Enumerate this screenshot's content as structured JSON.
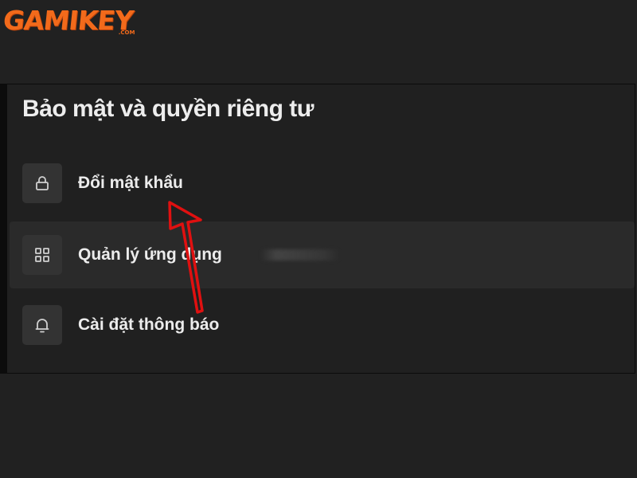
{
  "logo": {
    "text": "GAMIKEY",
    "sub": ".COM"
  },
  "settings": {
    "title": "Bảo mật và quyền riêng tư",
    "items": [
      {
        "label": "Đổi mật khẩu",
        "icon": "lock-icon"
      },
      {
        "label": "Quản lý ứng dụng",
        "icon": "grid-apps-icon"
      },
      {
        "label": "Cài đặt thông báo",
        "icon": "bell-icon"
      }
    ]
  },
  "colors": {
    "background": "#212121",
    "logo": "#f26a1b",
    "annotation_arrow": "#e01010",
    "text": "#ececec",
    "icon_tile": "#333333"
  }
}
